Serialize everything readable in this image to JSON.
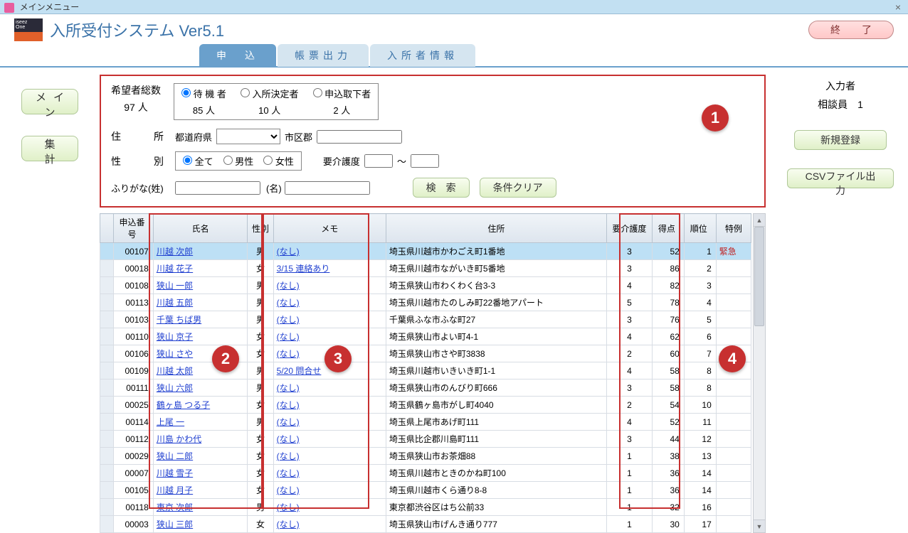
{
  "window": {
    "title": "メインメニュー",
    "close": "×"
  },
  "header": {
    "app_title": "入所受付システム Ver5.1",
    "exit": "終　了"
  },
  "sidebar": {
    "main": "メイン",
    "aggregate": "集　計"
  },
  "tabs": {
    "apply": "申　込",
    "report": "帳票出力",
    "resident": "入所者情報"
  },
  "filter": {
    "total_label": "希望者総数",
    "total_count": "97 人",
    "status": [
      {
        "label": "待 機 者",
        "count": "85 人",
        "checked": true
      },
      {
        "label": "入所決定者",
        "count": "10 人",
        "checked": false
      },
      {
        "label": "申込取下者",
        "count": "2 人",
        "checked": false
      }
    ],
    "addr_label": "住　　所",
    "pref_label": "都道府県",
    "city_label": "市区郡",
    "gender_label": "性　　別",
    "gender_all": "全て",
    "gender_m": "男性",
    "gender_f": "女性",
    "care_label": "要介護度",
    "care_sep": "～",
    "kana_label": "ふりがな(姓)",
    "kana_name_label": "(名)",
    "search": "検　索",
    "clear": "条件クリア"
  },
  "right": {
    "user_role": "入力者",
    "user_name": "相談員　1",
    "new_reg": "新規登録",
    "csv": "CSVファイル出力"
  },
  "grid": {
    "headers": {
      "id": "申込番号",
      "name": "氏名",
      "sex": "性別",
      "memo": "メモ",
      "addr": "住所",
      "care": "要介護度",
      "score": "得点",
      "rank": "順位",
      "spec": "特例"
    },
    "rows": [
      {
        "id": "00107",
        "name": "川越 次郎",
        "sex": "男",
        "memo": "(なし)",
        "addr": "埼玉県川越市かわごえ町1番地",
        "care": "3",
        "score": "52",
        "rank": "1",
        "spec": "緊急",
        "sel": true
      },
      {
        "id": "00018",
        "name": "川越 花子",
        "sex": "女",
        "memo": "3/15 連絡あり",
        "addr": "埼玉県川越市ながいき町5番地",
        "care": "3",
        "score": "86",
        "rank": "2",
        "spec": ""
      },
      {
        "id": "00108",
        "name": "狭山 一郎",
        "sex": "男",
        "memo": "(なし)",
        "addr": "埼玉県狭山市わくわく台3-3",
        "care": "4",
        "score": "82",
        "rank": "3",
        "spec": ""
      },
      {
        "id": "00113",
        "name": "川越 五郎",
        "sex": "男",
        "memo": "(なし)",
        "addr": "埼玉県川越市たのしみ町22番地アパート",
        "care": "5",
        "score": "78",
        "rank": "4",
        "spec": ""
      },
      {
        "id": "00103",
        "name": "千葉 ちば男",
        "sex": "男",
        "memo": "(なし)",
        "addr": "千葉県ふな市ふな町27",
        "care": "3",
        "score": "76",
        "rank": "5",
        "spec": ""
      },
      {
        "id": "00110",
        "name": "狭山 京子",
        "sex": "女",
        "memo": "(なし)",
        "addr": "埼玉県狭山市よい町4-1",
        "care": "4",
        "score": "62",
        "rank": "6",
        "spec": ""
      },
      {
        "id": "00106",
        "name": "狭山 さや",
        "sex": "女",
        "memo": "(なし)",
        "addr": "埼玉県狭山市さや町3838",
        "care": "2",
        "score": "60",
        "rank": "7",
        "spec": ""
      },
      {
        "id": "00109",
        "name": "川越 太郎",
        "sex": "男",
        "memo": "5/20 問合せ",
        "addr": "埼玉県川越市いきいき町1-1",
        "care": "4",
        "score": "58",
        "rank": "8",
        "spec": ""
      },
      {
        "id": "00111",
        "name": "狭山 六郎",
        "sex": "男",
        "memo": "(なし)",
        "addr": "埼玉県狭山市のんびり町666",
        "care": "3",
        "score": "58",
        "rank": "8",
        "spec": ""
      },
      {
        "id": "00025",
        "name": "鶴ヶ島 つる子",
        "sex": "女",
        "memo": "(なし)",
        "addr": "埼玉県鶴ヶ島市がし町4040",
        "care": "2",
        "score": "54",
        "rank": "10",
        "spec": ""
      },
      {
        "id": "00114",
        "name": "上尾 一",
        "sex": "男",
        "memo": "(なし)",
        "addr": "埼玉県上尾市あげ町111",
        "care": "4",
        "score": "52",
        "rank": "11",
        "spec": ""
      },
      {
        "id": "00112",
        "name": "川島 かわ代",
        "sex": "女",
        "memo": "(なし)",
        "addr": "埼玉県比企郡川島町111",
        "care": "3",
        "score": "44",
        "rank": "12",
        "spec": ""
      },
      {
        "id": "00029",
        "name": "狭山 二郎",
        "sex": "女",
        "memo": "(なし)",
        "addr": "埼玉県狭山市お茶畑88",
        "care": "1",
        "score": "38",
        "rank": "13",
        "spec": ""
      },
      {
        "id": "00007",
        "name": "川越 雪子",
        "sex": "女",
        "memo": "(なし)",
        "addr": "埼玉県川越市ときのかね町100",
        "care": "1",
        "score": "36",
        "rank": "14",
        "spec": ""
      },
      {
        "id": "00105",
        "name": "川越 月子",
        "sex": "女",
        "memo": "(なし)",
        "addr": "埼玉県川越市くら通り8-8",
        "care": "1",
        "score": "36",
        "rank": "14",
        "spec": ""
      },
      {
        "id": "00118",
        "name": "東京 次郎",
        "sex": "男",
        "memo": "(なし)",
        "addr": "東京都渋谷区はち公前33",
        "care": "1",
        "score": "32",
        "rank": "16",
        "spec": ""
      },
      {
        "id": "00003",
        "name": "狭山 三郎",
        "sex": "女",
        "memo": "(なし)",
        "addr": "埼玉県狭山市げんき通り777",
        "care": "1",
        "score": "30",
        "rank": "17",
        "spec": ""
      }
    ]
  },
  "callouts": {
    "c1": "1",
    "c2": "2",
    "c3": "3",
    "c4": "4"
  }
}
